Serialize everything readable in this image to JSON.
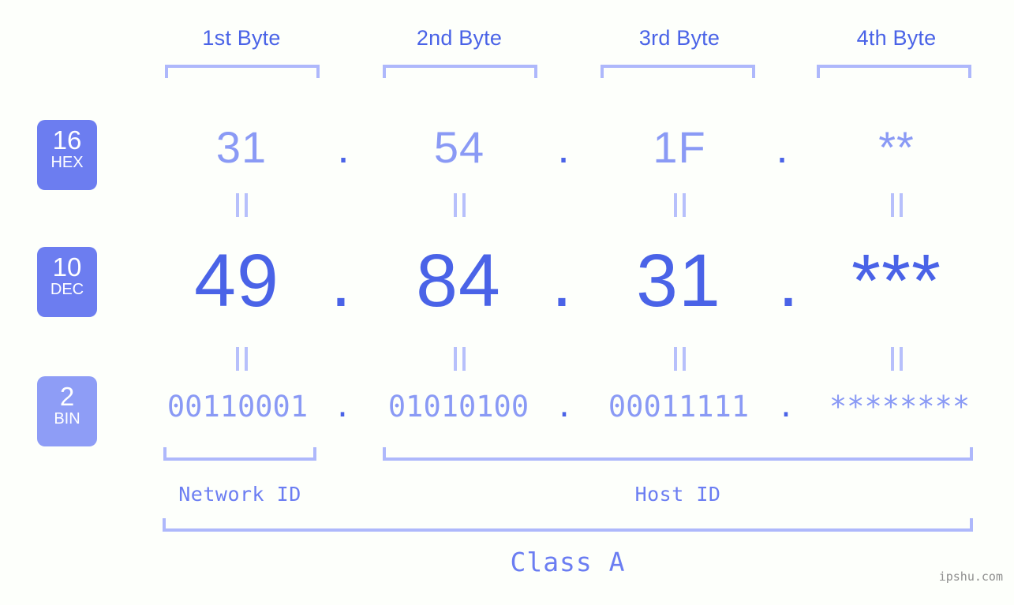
{
  "page": {
    "background_color": "#fdfffb",
    "accent_strong": "#4a63e7",
    "accent_light": "#8a9af5",
    "bracket_color": "#aeb8fb",
    "badge_color": "#6c7df0",
    "badge_color_light": "#8e9df6",
    "watermark": "ipshu.com"
  },
  "columns": [
    {
      "header": "1st Byte"
    },
    {
      "header": "2nd Byte"
    },
    {
      "header": "3rd Byte"
    },
    {
      "header": "4th Byte"
    }
  ],
  "separators": {
    "dot": "."
  },
  "rows": [
    {
      "id": "hex",
      "badge_number": "16",
      "badge_abbr": "HEX",
      "values": [
        "31",
        "54",
        "1F",
        "**"
      ]
    },
    {
      "id": "dec",
      "badge_number": "10",
      "badge_abbr": "DEC",
      "values": [
        "49",
        "84",
        "31",
        "***"
      ]
    },
    {
      "id": "bin",
      "badge_number": "2",
      "badge_abbr": "BIN",
      "values": [
        "00110001",
        "01010100",
        "00011111",
        "********"
      ]
    }
  ],
  "equals_symbol": "||",
  "footer": {
    "network_id_label": "Network ID",
    "host_id_label": "Host ID",
    "class_label": "Class A"
  }
}
